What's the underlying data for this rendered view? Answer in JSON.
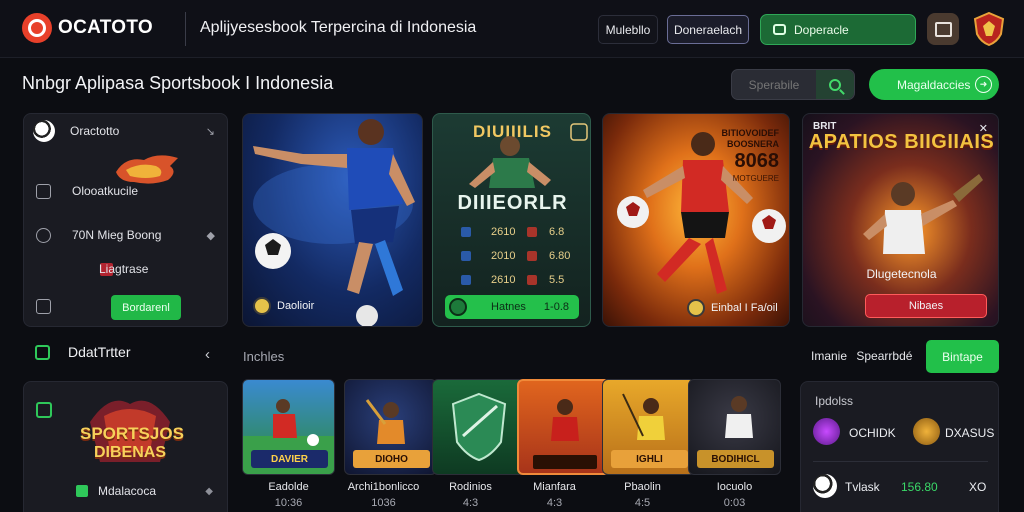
{
  "brand": {
    "name": "OCATOTO",
    "tagline": "Aplijyesesbook Terpercina di Indonesia"
  },
  "topbar": {
    "login_label": "Mulebllo",
    "register_label": "Doneraelach",
    "deposit_label": "Doperacle"
  },
  "page_title": "Nnbgr Aplipasa Sportsbook I Indonesia",
  "search": {
    "placeholder": "Sperabile"
  },
  "promo_button": {
    "label": "Magaldaccies"
  },
  "side_panel": {
    "items": [
      {
        "label": "Oractotto",
        "right": "↘"
      },
      {
        "label": "Olooatkucile"
      },
      {
        "label": "70N Mieg Boong"
      },
      {
        "label": "Liagtrase"
      }
    ],
    "button_label": "Bordarenl"
  },
  "banners": [
    {
      "chip": "Daolioir"
    },
    {
      "logo": "DIUIIILIS",
      "title": "DIIIEORLR",
      "odds": [
        [
          "2610",
          "6.8"
        ],
        [
          "2010",
          "6.80"
        ],
        [
          "2610",
          "5.5"
        ]
      ],
      "chip_left": "Hatnes",
      "chip_right": "1-0.8"
    },
    {
      "header": "BITIOVOIDEF BOOSNERA",
      "big": "8068",
      "note": "MOTGUERE",
      "chip": "Einbal I Fa/oil"
    },
    {
      "top": "BRIT",
      "title": "APATIOS BIIGIIAIS",
      "sub": "Dlugetecnola",
      "chip": "Nibaes",
      "close": "✕"
    }
  ],
  "section_left": {
    "title": "DdatTrtter",
    "chevron": "‹"
  },
  "section_games": {
    "title": "Inchles"
  },
  "section_right": {
    "link_1": "Imanie",
    "link_2": "Spearrbdé",
    "button_label": "Bintape"
  },
  "bottom_left": {
    "logo_line_1": "SPORTSJOS",
    "logo_line_2": "DIBENAS",
    "row_label": "Mdalacoca"
  },
  "games": [
    {
      "name": "Eadolde",
      "count": "10:36",
      "label": "DAVIER"
    },
    {
      "name": "Archi1bonlicco",
      "count": "1036",
      "label": "DIOHO"
    },
    {
      "name": "Rodinios",
      "count": "4:3",
      "label": ""
    },
    {
      "name": "Mianfara",
      "count": "4:3",
      "label": ""
    },
    {
      "name": "Pbaolin",
      "count": "4:5",
      "label": "IGHLI"
    },
    {
      "name": "Iocuolo",
      "count": "0:03",
      "label": "BODIHICL"
    }
  ],
  "leaderboard": {
    "title": "Ipdolss",
    "rows": [
      {
        "left": "OCHIDK",
        "right": "DXASUS"
      },
      {
        "left": "Tvlask",
        "score": "156.80",
        "right": "XO"
      }
    ]
  }
}
